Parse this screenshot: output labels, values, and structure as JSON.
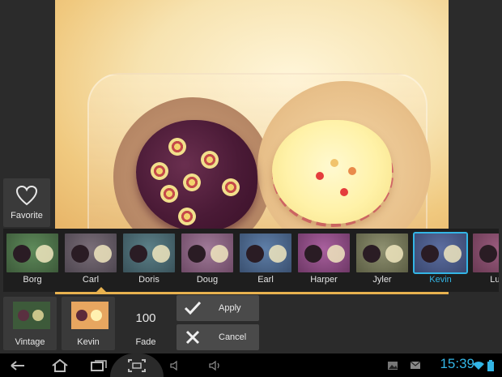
{
  "favorite": {
    "label": "Favorite",
    "icon": "heart-outline-icon"
  },
  "filters": [
    {
      "label": "Borg",
      "tint": "#5e8a5a",
      "bg": "#3d5a3a"
    },
    {
      "label": "Carl",
      "tint": "#7a6e78",
      "bg": "#4e4650"
    },
    {
      "label": "Doris",
      "tint": "#5c8088",
      "bg": "#39525a"
    },
    {
      "label": "Doug",
      "tint": "#a07a98",
      "bg": "#6e4a66"
    },
    {
      "label": "Earl",
      "tint": "#5f7fa8",
      "bg": "#3a5070"
    },
    {
      "label": "Harper",
      "tint": "#a9609e",
      "bg": "#6e3866"
    },
    {
      "label": "Jyler",
      "tint": "#8e9070",
      "bg": "#5c5e44"
    },
    {
      "label": "Kevin",
      "tint": "#5c6ea0",
      "bg": "#3a4870"
    },
    {
      "label": "Lum",
      "tint": "#9a5c7e",
      "bg": "#6a3a54"
    }
  ],
  "selected_filter": "Kevin",
  "controls": {
    "vintage": {
      "label": "Vintage"
    },
    "kevin": {
      "label": "Kevin"
    },
    "fade": {
      "value": "100",
      "label": "Fade"
    },
    "apply": {
      "label": "Apply",
      "icon": "check-icon"
    },
    "cancel": {
      "label": "Cancel",
      "icon": "close-icon"
    }
  },
  "statusbar": {
    "time": "15:39",
    "icons": [
      "gallery-icon",
      "mail-icon",
      "wifi-icon",
      "battery-icon"
    ]
  },
  "navbar": {
    "icons": [
      "back-icon",
      "home-icon",
      "recent-apps-icon",
      "screenshot-icon",
      "volume-down-icon",
      "volume-up-icon"
    ]
  },
  "colors": {
    "accent": "#33b5e5",
    "strip_accent": "#e8b24f"
  }
}
